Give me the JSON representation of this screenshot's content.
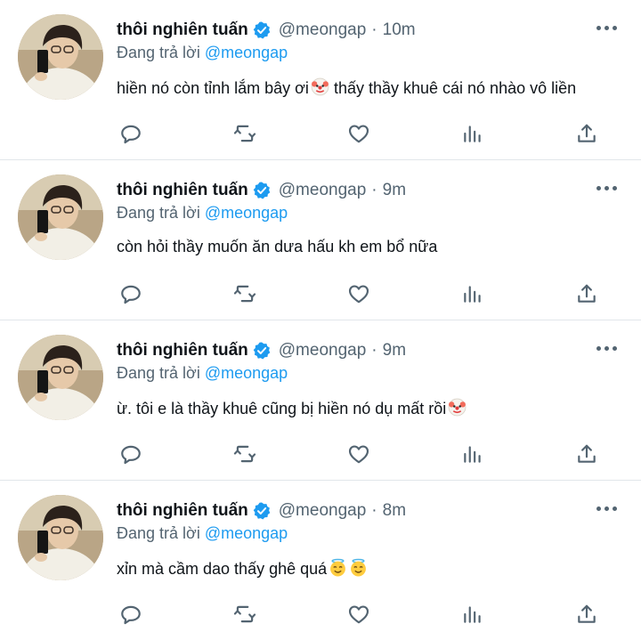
{
  "tweets": [
    {
      "name": "thôi nghiên tuấn",
      "handle": "@meongap",
      "time": "10m",
      "reply_prefix": "Đang trả lời",
      "reply_to": "@meongap",
      "text": "hiền nó còn tỉnh lắm bây ơi",
      "text_after": " thấy thầy khuê cái nó nhào vô liền",
      "emoji_1": "clown-face-icon",
      "emoji_2": ""
    },
    {
      "name": "thôi nghiên tuấn",
      "handle": "@meongap",
      "time": "9m",
      "reply_prefix": "Đang trả lời",
      "reply_to": "@meongap",
      "text": "còn hỏi thầy muốn ăn dưa hấu kh em bổ nữa",
      "text_after": "",
      "emoji_1": "",
      "emoji_2": ""
    },
    {
      "name": "thôi nghiên tuấn",
      "handle": "@meongap",
      "time": "9m",
      "reply_prefix": "Đang trả lời",
      "reply_to": "@meongap",
      "text": "ừ. tôi e là thầy khuê cũng bị hiền nó dụ mất rồi",
      "text_after": "",
      "emoji_1": "clown-face-icon",
      "emoji_2": ""
    },
    {
      "name": "thôi nghiên tuấn",
      "handle": "@meongap",
      "time": "8m",
      "reply_prefix": "Đang trả lời",
      "reply_to": "@meongap",
      "text": "xỉn mà cầm dao thấy ghê quá",
      "text_after": "",
      "emoji_1": "smiling-face-with-halo-icon",
      "emoji_2": "smiling-face-with-halo-icon"
    }
  ],
  "separator": "·",
  "icons": {
    "verified": "verified-badge-icon",
    "more": "more-options-icon",
    "reply": "reply-icon",
    "retweet": "retweet-icon",
    "like": "like-icon",
    "views": "views-icon",
    "share": "share-icon"
  },
  "colors": {
    "accent": "#1d9bf0",
    "secondary_text": "#536471",
    "primary_text": "#0f1419",
    "divider": "#e1e6ea"
  }
}
